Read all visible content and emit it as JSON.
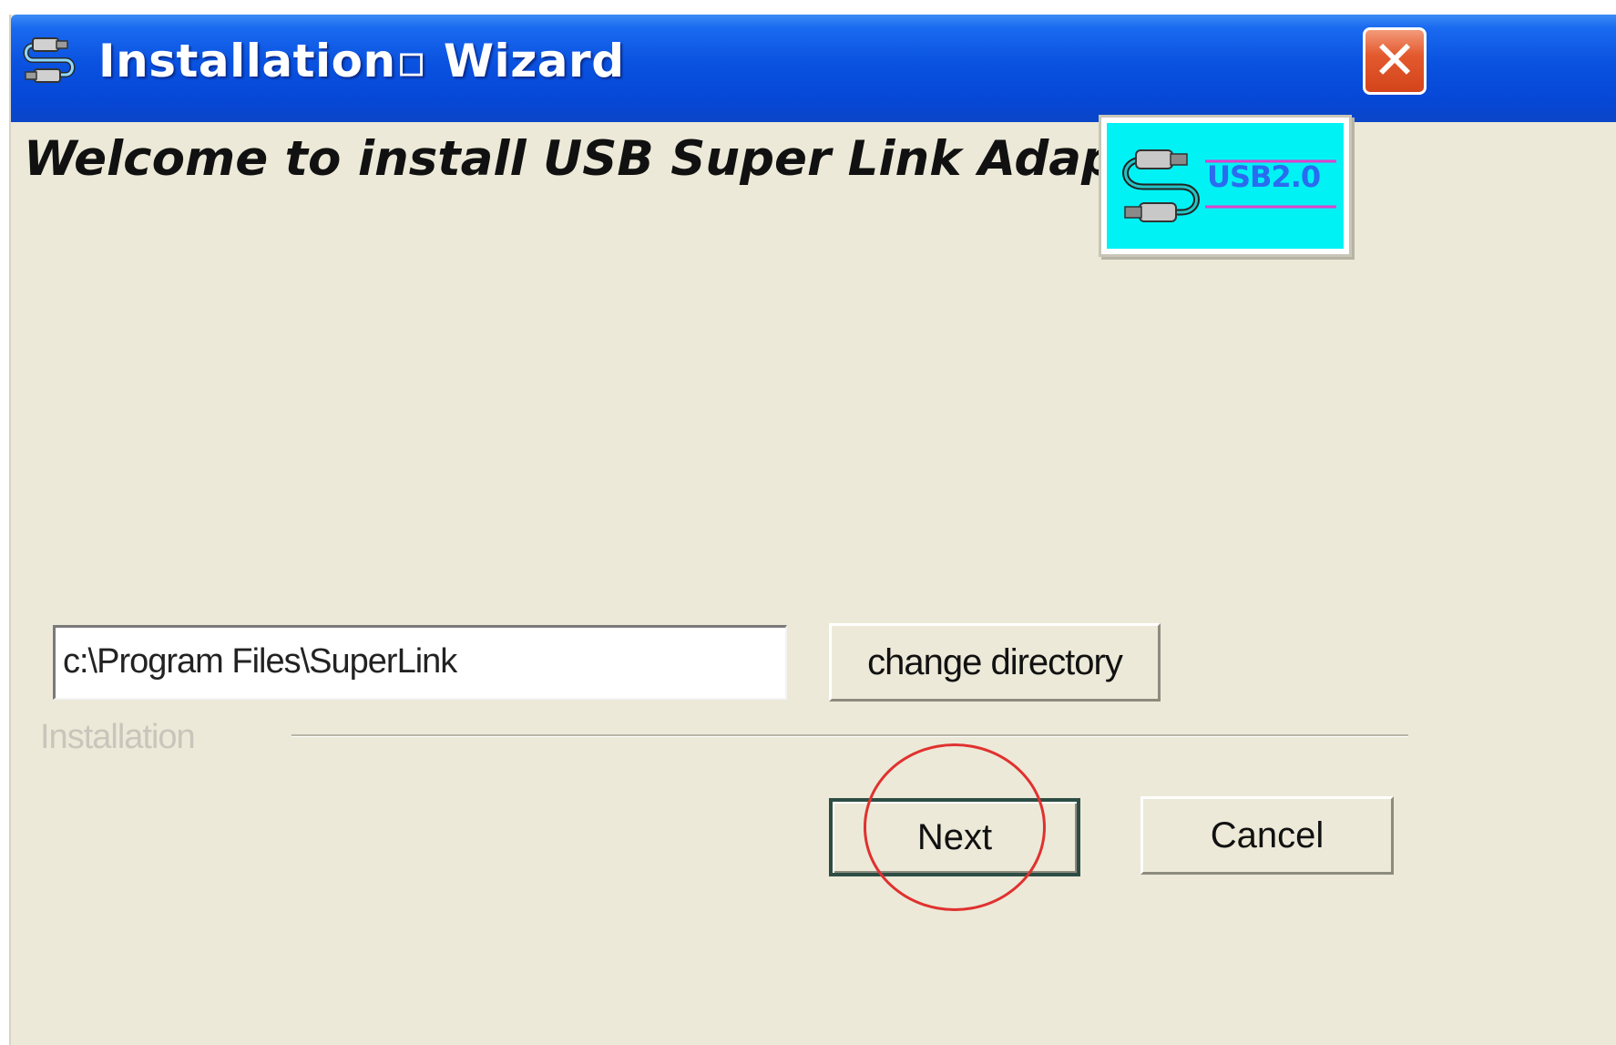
{
  "window": {
    "title": "Installation▫ Wizard",
    "close_label": "✕"
  },
  "main": {
    "welcome_text": "Welcome to install USB Super Link Adapter",
    "logo_text": "USB2.0",
    "install_path": "c:\\Program Files\\SuperLink",
    "change_directory_label": "change directory",
    "group_label": "Installation",
    "next_label": "Next",
    "cancel_label": "Cancel"
  },
  "icons": {
    "app": "usb-cable-icon",
    "close": "close-icon",
    "logo": "usb-logo-icon"
  },
  "colors": {
    "titlebar": "#0a52e0",
    "window_bg": "#ece9d8",
    "logo_bg": "#00f2f5",
    "close_bg": "#d4441b",
    "highlight": "#e0312f"
  }
}
